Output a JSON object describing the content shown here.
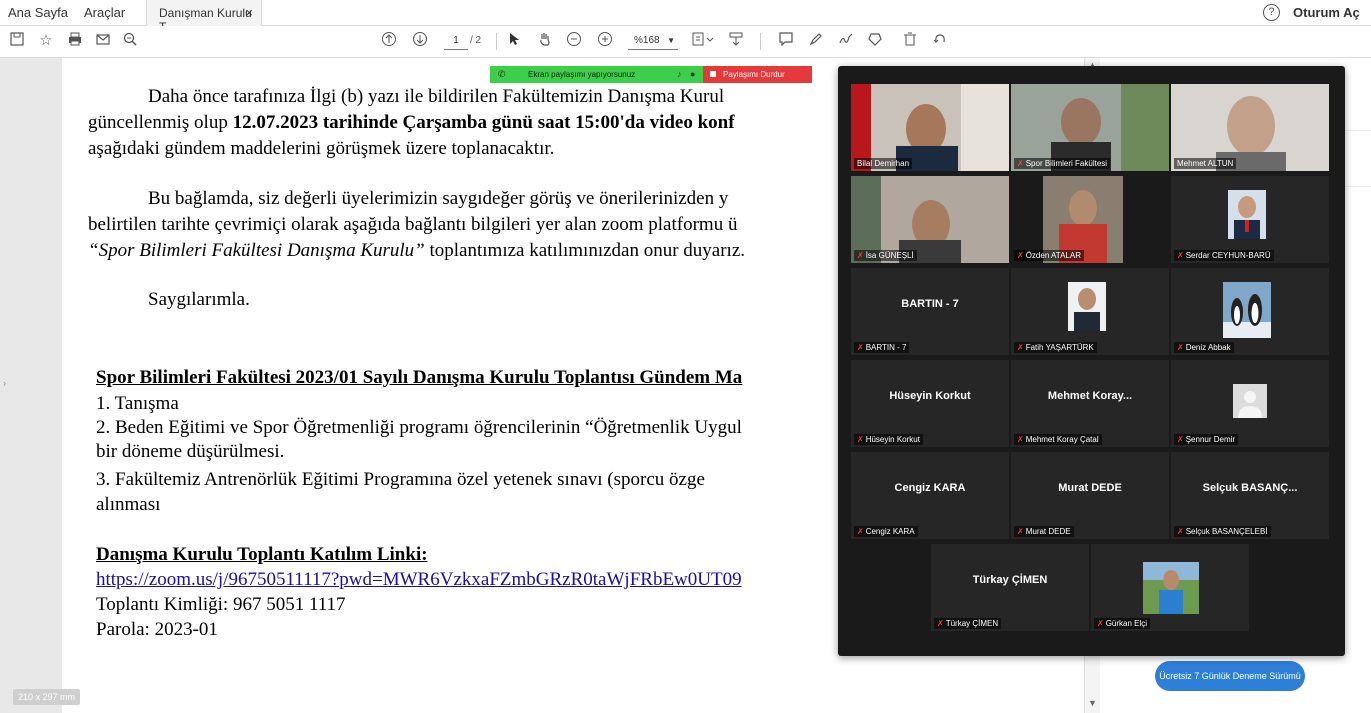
{
  "menu": {
    "home": "Ana Sayfa",
    "tools": "Araçlar",
    "doc_tab": "Danışman Kurulu T...",
    "tab_close": "×",
    "help": "?",
    "signin": "Oturum Aç"
  },
  "toolbar": {
    "page_current": "1",
    "page_total": "/ 2",
    "zoom": "%168",
    "icons": [
      "save-icon",
      "bookmark-star-icon",
      "print-icon",
      "email-icon",
      "zoom-search-icon",
      "page-up-icon",
      "page-down-icon",
      "select-arrow-icon",
      "hand-icon",
      "zoom-out-icon",
      "zoom-in-icon",
      "page-fit-icon",
      "scroll-mode-icon",
      "comment-icon",
      "highlight-pen-icon",
      "signature-icon",
      "stamp-icon",
      "delete-icon",
      "undo-icon"
    ]
  },
  "document": {
    "p1_l1": "Daha önce tarafınıza İlgi (b) yazı ile bildirilen Fakültemizin Danışma Kurul",
    "p1_l2a": "güncellenmiş olup ",
    "p1_l2b": "12.07.2023 tarihinde Çarşamba günü saat 15:00'da video konf",
    "p1_l3": "aşağıdaki gündem maddelerini görüşmek üzere toplanacaktır.",
    "p2_l1": "Bu bağlamda, siz değerli üyelerimizin saygıdeğer görüş ve önerilerinizden y",
    "p2_l2": "belirtilen tarihte çevrimiçi olarak aşağıda bağlantı bilgileri yer alan zoom platformu ü",
    "p2_l3a": "“Spor Bilimleri Fakültesi Danışma Kurulu”",
    "p2_l3b": " toplantımıza katılımınızdan onur duyarız.",
    "regards": "Saygılarımla.",
    "agenda_title": "Spor Bilimleri Fakültesi 2023/01 Sayılı Danışma Kurulu Toplantısı Gündem Ma",
    "item1": "1. Tanışma",
    "item2_l1": "2. Beden Eğitimi ve Spor Öğretmenliği programı öğrencilerinin “Öğretmenlik Uygul",
    "item2_l2": "bir döneme düşürülmesi.",
    "item3_l1": "3. Fakültemiz Antrenörlük Eğitimi Programına özel yetenek sınavı (sporcu özge",
    "item3_l2": "alınması",
    "link_title": "Danışma Kurulu Toplantı Katılım Linki:",
    "link": "https://zoom.us/j/96750511117?pwd=MWR6VzkxaFZmbGRzR0taWjFRbEw0UT09",
    "meeting_id": "Toplantı Kimliği: 967 5051 1117",
    "password": "Parola: 2023-01",
    "page_size": "210 x 297 mm"
  },
  "share_bar": {
    "status": "Ekran paylaşımı yapıyorsunuz",
    "stop": "Paylaşımı Durdur",
    "status_color": "#3ecf4a",
    "stop_color": "#e5393a"
  },
  "participants": [
    {
      "name": "Bilal Demirhan",
      "label": "",
      "muted": false,
      "kind": "video"
    },
    {
      "name": "Spor Bilimleri Fakültesi",
      "label": "",
      "muted": true,
      "kind": "video"
    },
    {
      "name": "Mehmet ALTUN",
      "label": "",
      "muted": false,
      "kind": "video",
      "active": true
    },
    {
      "name": "İsa GÜNEŞLİ",
      "label": "",
      "muted": true,
      "kind": "video"
    },
    {
      "name": "Özden ATALAR",
      "label": "",
      "muted": true,
      "kind": "video"
    },
    {
      "name": "Serdar CEYHUN-BARÜ",
      "label": "",
      "muted": true,
      "kind": "photo"
    },
    {
      "name": "BARTIN - 7",
      "label": "BARTIN - 7",
      "muted": true,
      "kind": "text"
    },
    {
      "name": "Fatih YAŞARTÜRK",
      "label": "",
      "muted": true,
      "kind": "photo"
    },
    {
      "name": "Deniz Abbak",
      "label": "",
      "muted": true,
      "kind": "photo"
    },
    {
      "name": "Hüseyin Korkut",
      "label": "Hüseyin Korkut",
      "muted": true,
      "kind": "text"
    },
    {
      "name": "Mehmet Koray Çatal",
      "label": "Mehmet Koray...",
      "muted": true,
      "kind": "text"
    },
    {
      "name": "Şennur Demir",
      "label": "",
      "muted": true,
      "kind": "placeholder"
    },
    {
      "name": "Cengiz KARA",
      "label": "Cengiz KARA",
      "muted": true,
      "kind": "text"
    },
    {
      "name": "Murat DEDE",
      "label": "Murat DEDE",
      "muted": true,
      "kind": "text"
    },
    {
      "name": "Selçuk BASANÇELEBİ",
      "label": "Selçuk BASANÇ...",
      "muted": true,
      "kind": "text"
    },
    {
      "name": "Türkay ÇİMEN",
      "label": "Türkay ÇİMEN",
      "muted": true,
      "kind": "text"
    },
    {
      "name": "Gürkan Elçi",
      "label": "",
      "muted": true,
      "kind": "photo"
    }
  ],
  "right_panel": {
    "trial_button": "Ücretsiz 7 Günlük Deneme Sürümü",
    "accent": "#2d7fd8"
  }
}
